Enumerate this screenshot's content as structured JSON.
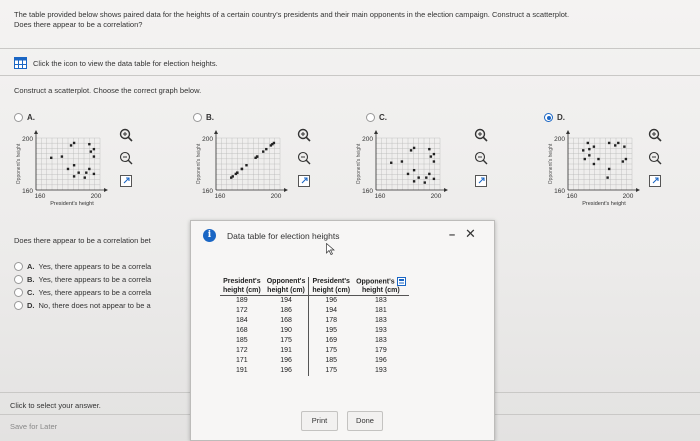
{
  "question": {
    "line1": "The table provided below shows paired data for the heights of a certain country's presidents and their main opponents in the election campaign. Construct a scatterplot.",
    "line2": "Does there appear to be a correlation?"
  },
  "table_link_text": "Click the icon to view the data table for election heights.",
  "instruction": "Construct a scatterplot. Choose the correct graph below.",
  "graph_options": [
    {
      "letter": "A.",
      "selected": false
    },
    {
      "letter": "B.",
      "selected": false
    },
    {
      "letter": "C.",
      "selected": false
    },
    {
      "letter": "D.",
      "selected": true
    }
  ],
  "graph_labels": {
    "y_label": "Opponent's height",
    "x_label": "President's height",
    "y_tick_top": "200",
    "y_tick_bottom": "160",
    "x_tick_left": "160",
    "x_tick_right": "200"
  },
  "correlation_question": "Does there appear to be a correlation bet",
  "answers": [
    {
      "letter": "A.",
      "text": "Yes, there appears to be a correla"
    },
    {
      "letter": "B.",
      "text": "Yes, there appears to be a correla"
    },
    {
      "letter": "C.",
      "text": "Yes, there appears to be a correla"
    },
    {
      "letter": "D.",
      "text": "No, there does not appear to be a"
    }
  ],
  "footer_hint": "Click to select your answer.",
  "save_later": "Save for Later",
  "dialog": {
    "title": "Data table for election heights",
    "minimize": "–",
    "close": "✕",
    "headers": [
      {
        "line1": "President's",
        "line2": "height (cm)"
      },
      {
        "line1": "Opponent's",
        "line2": "height (cm)"
      },
      {
        "line1": "President's",
        "line2": "height (cm)"
      },
      {
        "line1": "Opponent's",
        "line2": "height (cm)"
      }
    ],
    "rows": [
      [
        "189",
        "194",
        "196",
        "183"
      ],
      [
        "172",
        "186",
        "194",
        "181"
      ],
      [
        "184",
        "168",
        "178",
        "183"
      ],
      [
        "168",
        "190",
        "195",
        "193"
      ],
      [
        "185",
        "175",
        "169",
        "183"
      ],
      [
        "172",
        "191",
        "175",
        "179"
      ],
      [
        "171",
        "196",
        "185",
        "196"
      ],
      [
        "191",
        "196",
        "175",
        "193"
      ]
    ],
    "print_label": "Print",
    "done_label": "Done"
  },
  "colors": {
    "accent": "#1a66c4",
    "point": "#222222",
    "grid": "#b7b7b7"
  }
}
